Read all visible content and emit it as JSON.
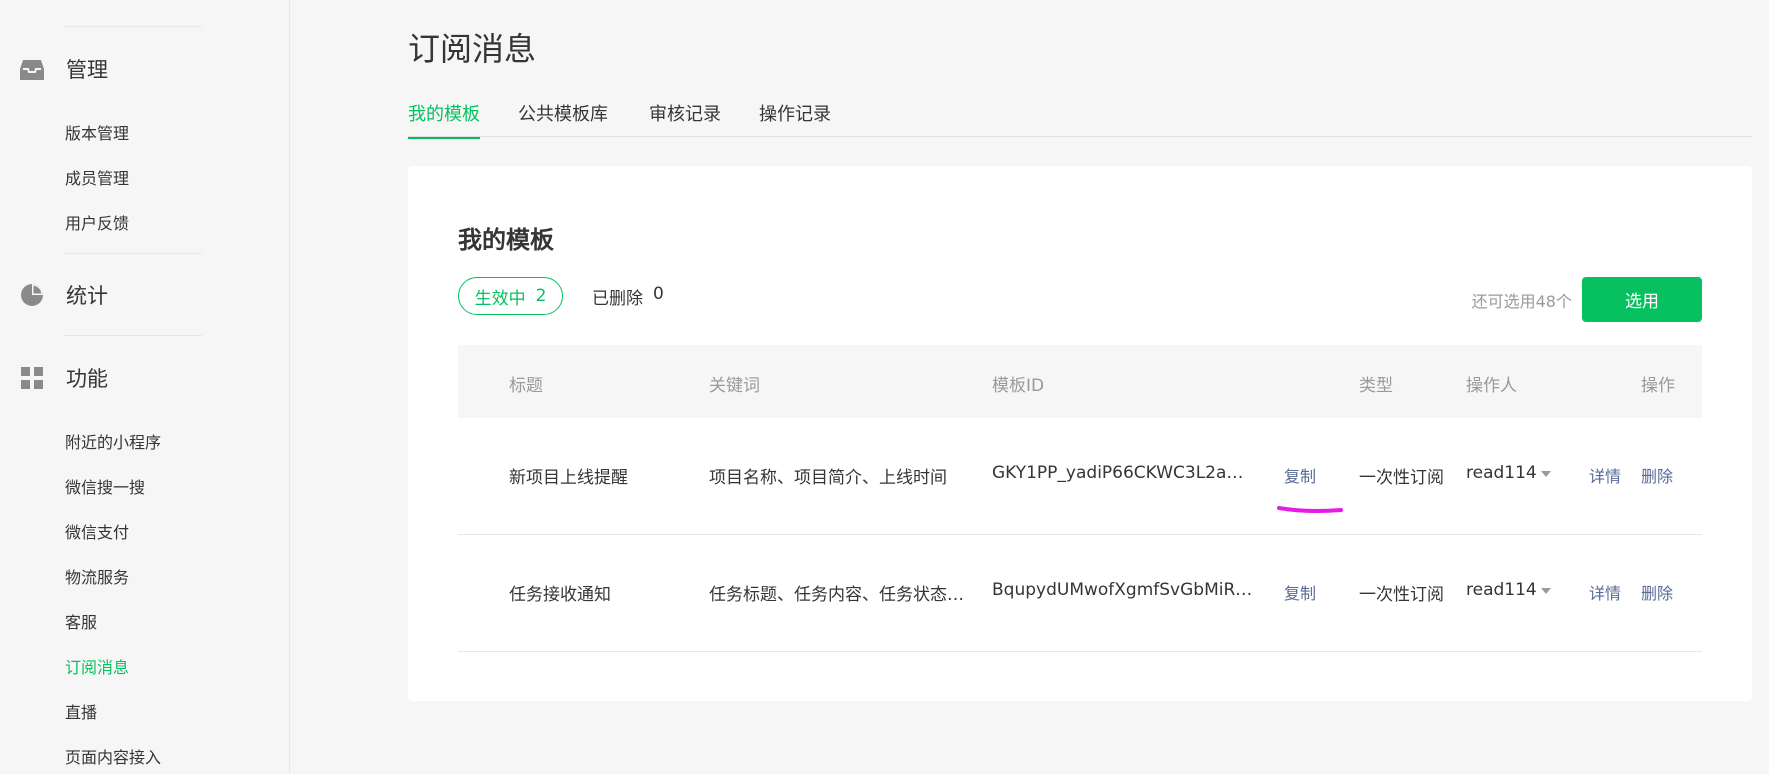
{
  "sidebar": {
    "groups": [
      {
        "label": "管理",
        "icon": "inbox-icon",
        "items": [
          "版本管理",
          "成员管理",
          "用户反馈"
        ]
      },
      {
        "label": "统计",
        "icon": "pie-chart-icon",
        "items": []
      },
      {
        "label": "功能",
        "icon": "grid-icon",
        "items": [
          "附近的小程序",
          "微信搜一搜",
          "微信支付",
          "物流服务",
          "客服",
          "订阅消息",
          "直播",
          "页面内容接入"
        ]
      }
    ],
    "active_item": "订阅消息"
  },
  "page": {
    "title": "订阅消息",
    "tabs": [
      {
        "label": "我的模板",
        "active": true
      },
      {
        "label": "公共模板库",
        "active": false
      },
      {
        "label": "审核记录",
        "active": false
      },
      {
        "label": "操作记录",
        "active": false
      }
    ]
  },
  "card": {
    "title": "我的模板",
    "filter_active": {
      "label": "生效中",
      "count": "2"
    },
    "filter_deleted": {
      "label": "已删除",
      "count": "0"
    },
    "remaining": "还可选用48个",
    "select_button": "选用"
  },
  "table": {
    "headers": [
      "标题",
      "关键词",
      "模板ID",
      "类型",
      "操作人",
      "操作"
    ],
    "rows": [
      {
        "title": "新项目上线提醒",
        "keywords": "项目名称、项目简介、上线时间",
        "template_id": "GKY1PP_yadiP66CKWC3L2a…",
        "copy": "复制",
        "type": "一次性订阅",
        "operator": "read114",
        "detail": "详情",
        "delete": "删除"
      },
      {
        "title": "任务接收通知",
        "keywords": "任务标题、任务内容、任务状态…",
        "template_id": "BqupydUMwofXgmfSvGbMiR…",
        "copy": "复制",
        "type": "一次性订阅",
        "operator": "read114",
        "detail": "详情",
        "delete": "删除"
      }
    ]
  },
  "colors": {
    "accent": "#07c160",
    "link": "#576b95",
    "annotation": "#e61ce6"
  }
}
